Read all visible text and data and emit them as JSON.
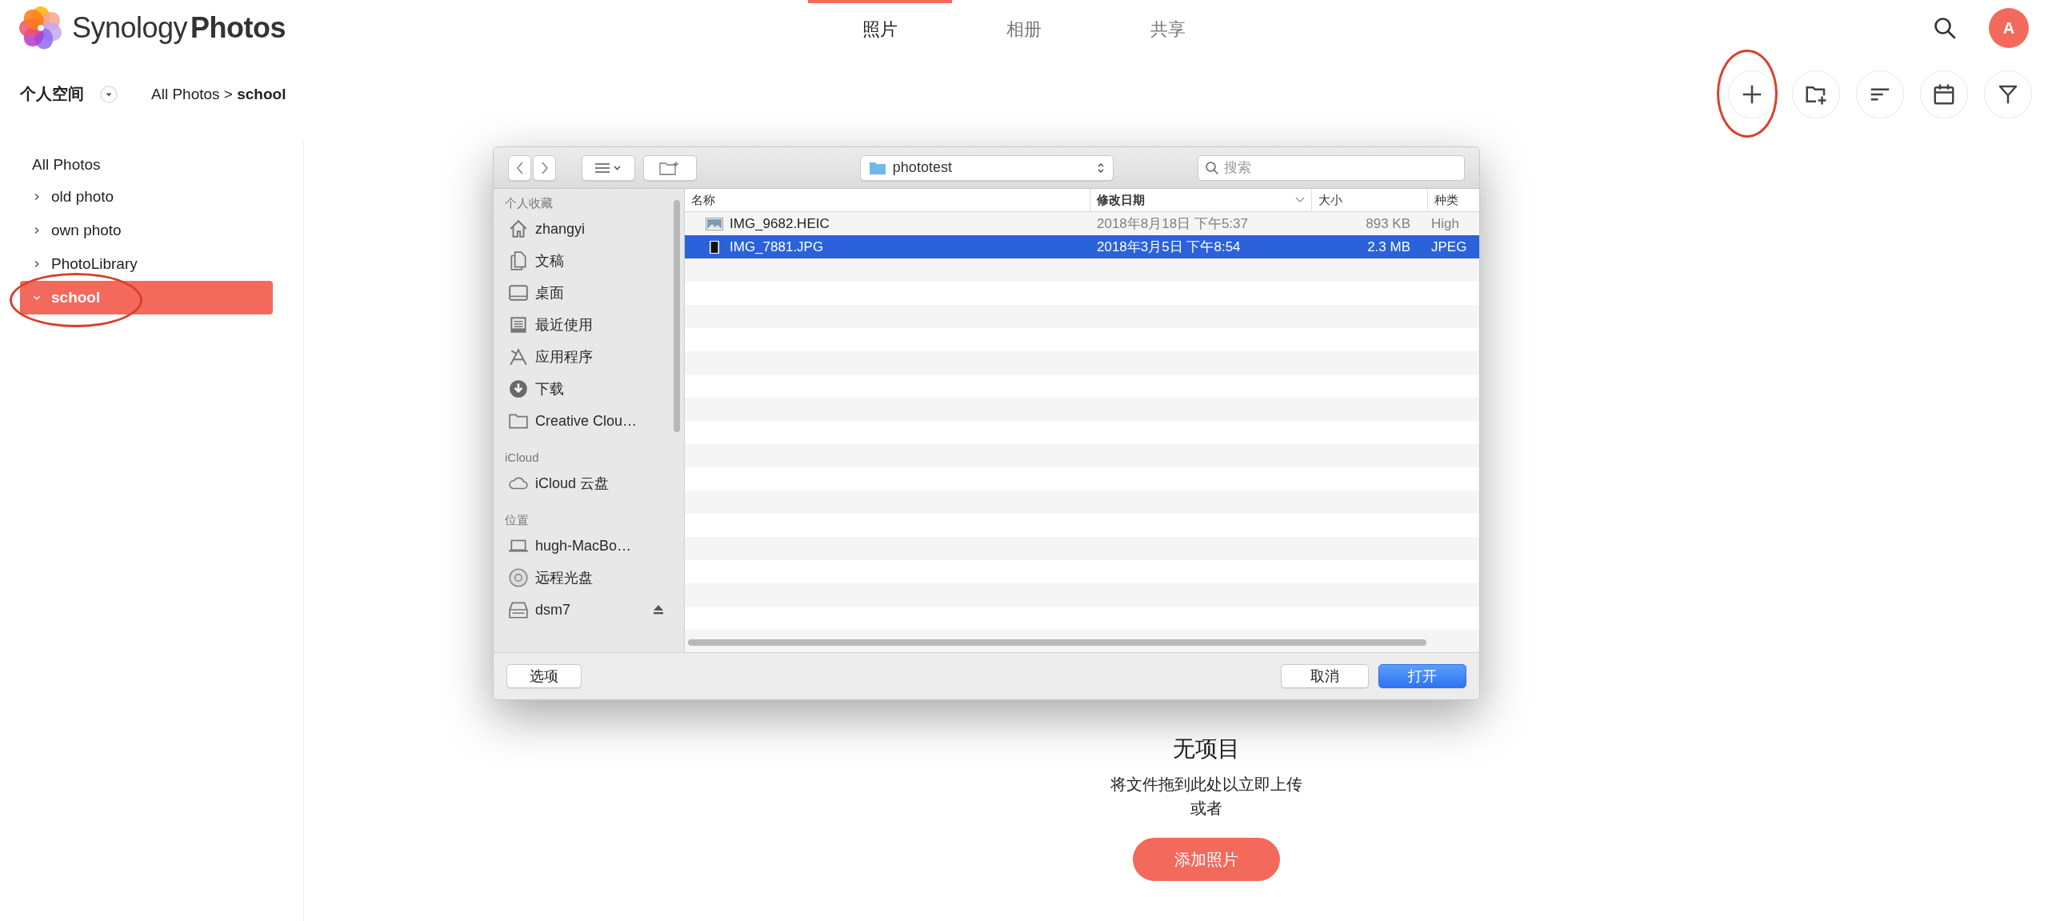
{
  "header": {
    "brand": {
      "light": "Synology",
      "bold": "Photos"
    },
    "tabs": [
      {
        "label": "照片",
        "selected": true
      },
      {
        "label": "相册",
        "selected": false
      },
      {
        "label": "共享",
        "selected": false
      }
    ],
    "avatar": "A"
  },
  "space": {
    "label": "个人空间"
  },
  "breadcrumb": "All Photos > **school**",
  "toolbar": [
    {
      "kind": "add",
      "circled": true
    },
    {
      "kind": "new-folder",
      "circled": false
    },
    {
      "kind": "sort",
      "circled": false
    },
    {
      "kind": "calendar",
      "circled": false
    },
    {
      "kind": "filter",
      "circled": false
    }
  ],
  "sidebar": {
    "label": "All Photos",
    "selected": false,
    "children": [
      {
        "label": "old photo",
        "expanded": false,
        "selected": false,
        "circled": false
      },
      {
        "label": "own photo",
        "expanded": false,
        "selected": false,
        "circled": false
      },
      {
        "label": "PhotoLibrary",
        "expanded": false,
        "selected": false,
        "circled": false
      },
      {
        "label": "school",
        "expanded": true,
        "selected": true,
        "circled": true
      }
    ]
  },
  "dialog": {
    "location": "phototest",
    "search_placeholder": "搜索",
    "sidebar": [
      {
        "title": "个人收藏",
        "items": [
          {
            "label": "zhangyi",
            "kind": "home",
            "ejectable": false
          },
          {
            "label": "文稿",
            "kind": "documents",
            "ejectable": false
          },
          {
            "label": "桌面",
            "kind": "desktop",
            "ejectable": false
          },
          {
            "label": "最近使用",
            "kind": "recents",
            "ejectable": false
          },
          {
            "label": "应用程序",
            "kind": "apps",
            "ejectable": false
          },
          {
            "label": "下载",
            "kind": "downloads",
            "ejectable": false
          },
          {
            "label": "Creative Clou…",
            "kind": "folder",
            "ejectable": false
          }
        ]
      },
      {
        "title": "iCloud",
        "items": [
          {
            "label": "iCloud 云盘",
            "kind": "cloud",
            "ejectable": false
          }
        ]
      },
      {
        "title": "位置",
        "items": [
          {
            "label": "hugh-MacBo…",
            "kind": "laptop",
            "ejectable": false
          },
          {
            "label": "远程光盘",
            "kind": "disc",
            "ejectable": false
          },
          {
            "label": "dsm7",
            "kind": "drive",
            "ejectable": true
          }
        ]
      }
    ],
    "columns": [
      {
        "label": "名称",
        "sorted": false
      },
      {
        "label": "修改日期",
        "sorted": true
      },
      {
        "label": "大小",
        "sorted": false
      },
      {
        "label": "种类",
        "sorted": false
      }
    ],
    "files": [
      {
        "name": "IMG_9682.HEIC",
        "modified": "2018年8月18日 下午5:37",
        "size": "893 KB",
        "type": "High",
        "kind": "landscape",
        "selected": false
      },
      {
        "name": "IMG_7881.JPG",
        "modified": "2018年3月5日 下午8:54",
        "size": "2.3 MB",
        "type": "JPEG",
        "kind": "portrait",
        "selected": true
      }
    ],
    "buttons": {
      "options": "选项",
      "cancel": "取消",
      "open": "打开"
    }
  },
  "empty_state": {
    "title": "无项目",
    "message": "将文件拖到此处以立即上传",
    "or": "或者",
    "button": "添加照片"
  }
}
